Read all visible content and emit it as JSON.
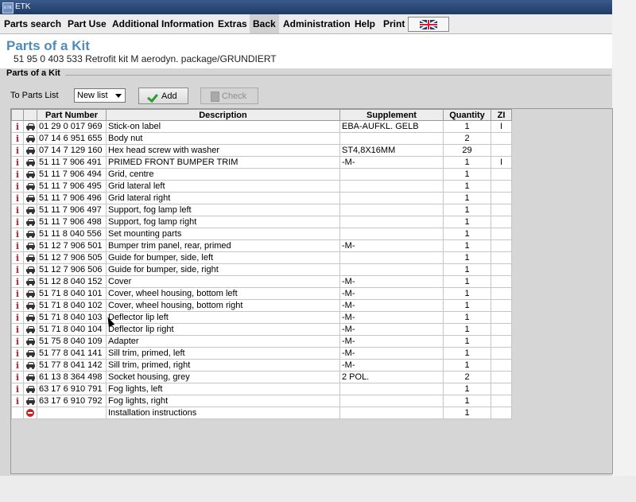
{
  "window": {
    "title": "ETK",
    "icon_text": "ETK"
  },
  "menu": [
    {
      "label": "Parts search",
      "active": false
    },
    {
      "label": "Part Use",
      "active": false
    },
    {
      "label": "Additional Information",
      "active": false
    },
    {
      "label": "Extras",
      "active": false
    },
    {
      "label": "Back",
      "active": true
    },
    {
      "label": "Administration",
      "active": false
    },
    {
      "label": "Help",
      "active": false
    },
    {
      "label": "Print",
      "active": false
    }
  ],
  "language_flag": "uk-flag-icon",
  "header": {
    "title": "Parts of a Kit",
    "subtitle": "51 95 0 403 533 Retrofit kit M aerodyn. package/GRUNDIERT"
  },
  "panel": {
    "title": "Parts of a Kit",
    "to_parts_label": "To Parts List",
    "list_select_value": "New list",
    "add_label": "Add",
    "check_label": "Check"
  },
  "table": {
    "headers": [
      "",
      "",
      "Part Number",
      "Description",
      "Supplement",
      "Quantity",
      "ZI"
    ],
    "rows": [
      {
        "icon": "info",
        "part": "01 29 0 017 969",
        "desc": "Stick-on label",
        "supp": "EBA-AUFKL. GELB",
        "qty": "1",
        "zi": "I"
      },
      {
        "icon": "info",
        "part": "07 14 6 951 655",
        "desc": "Body nut",
        "supp": "",
        "qty": "2",
        "zi": ""
      },
      {
        "icon": "info",
        "part": "07 14 7 129 160",
        "desc": "Hex head screw with washer",
        "supp": "ST4,8X16MM",
        "qty": "29",
        "zi": ""
      },
      {
        "icon": "info",
        "part": "51 11 7 906 491",
        "desc": "PRIMED FRONT BUMPER TRIM",
        "supp": "-M-",
        "qty": "1",
        "zi": "I"
      },
      {
        "icon": "info",
        "part": "51 11 7 906 494",
        "desc": "Grid, centre",
        "supp": "",
        "qty": "1",
        "zi": ""
      },
      {
        "icon": "info",
        "part": "51 11 7 906 495",
        "desc": "Grid lateral left",
        "supp": "",
        "qty": "1",
        "zi": ""
      },
      {
        "icon": "info",
        "part": "51 11 7 906 496",
        "desc": "Grid lateral right",
        "supp": "",
        "qty": "1",
        "zi": ""
      },
      {
        "icon": "info",
        "part": "51 11 7 906 497",
        "desc": "Support, fog lamp left",
        "supp": "",
        "qty": "1",
        "zi": ""
      },
      {
        "icon": "info",
        "part": "51 11 7 906 498",
        "desc": "Support, fog lamp right",
        "supp": "",
        "qty": "1",
        "zi": ""
      },
      {
        "icon": "info",
        "part": "51 11 8 040 556",
        "desc": "Set mounting parts",
        "supp": "",
        "qty": "1",
        "zi": ""
      },
      {
        "icon": "info",
        "part": "51 12 7 906 501",
        "desc": "Bumper trim panel, rear, primed",
        "supp": "-M-",
        "qty": "1",
        "zi": ""
      },
      {
        "icon": "info",
        "part": "51 12 7 906 505",
        "desc": "Guide for bumper, side, left",
        "supp": "",
        "qty": "1",
        "zi": ""
      },
      {
        "icon": "info",
        "part": "51 12 7 906 506",
        "desc": "Guide for bumper, side, right",
        "supp": "",
        "qty": "1",
        "zi": ""
      },
      {
        "icon": "info",
        "part": "51 12 8 040 152",
        "desc": "Cover",
        "supp": "-M-",
        "qty": "1",
        "zi": ""
      },
      {
        "icon": "info",
        "part": "51 71 8 040 101",
        "desc": "Cover, wheel housing, bottom left",
        "supp": "-M-",
        "qty": "1",
        "zi": ""
      },
      {
        "icon": "info",
        "part": "51 71 8 040 102",
        "desc": "Cover, wheel housing, bottom right",
        "supp": "-M-",
        "qty": "1",
        "zi": ""
      },
      {
        "icon": "info",
        "part": "51 71 8 040 103",
        "desc": "Deflector lip left",
        "supp": "-M-",
        "qty": "1",
        "zi": ""
      },
      {
        "icon": "info",
        "part": "51 71 8 040 104",
        "desc": "Deflector lip right",
        "supp": "-M-",
        "qty": "1",
        "zi": ""
      },
      {
        "icon": "info",
        "part": "51 75 8 040 109",
        "desc": "Adapter",
        "supp": "-M-",
        "qty": "1",
        "zi": ""
      },
      {
        "icon": "info",
        "part": "51 77 8 041 141",
        "desc": "Sill trim, primed, left",
        "supp": "-M-",
        "qty": "1",
        "zi": ""
      },
      {
        "icon": "info",
        "part": "51 77 8 041 142",
        "desc": "Sill trim, primed, right",
        "supp": "-M-",
        "qty": "1",
        "zi": ""
      },
      {
        "icon": "info",
        "part": "61 13 8 364 498",
        "desc": "Socket housing, grey",
        "supp": "2 POL.",
        "qty": "2",
        "zi": ""
      },
      {
        "icon": "info",
        "part": "63 17 6 910 791",
        "desc": "Fog lights, left",
        "supp": "",
        "qty": "1",
        "zi": ""
      },
      {
        "icon": "info",
        "part": "63 17 6 910 792",
        "desc": "Fog lights, right",
        "supp": "",
        "qty": "1",
        "zi": ""
      },
      {
        "icon": "none",
        "part": "",
        "desc": "Installation instructions",
        "supp": "",
        "qty": "1",
        "zi": ""
      }
    ]
  }
}
